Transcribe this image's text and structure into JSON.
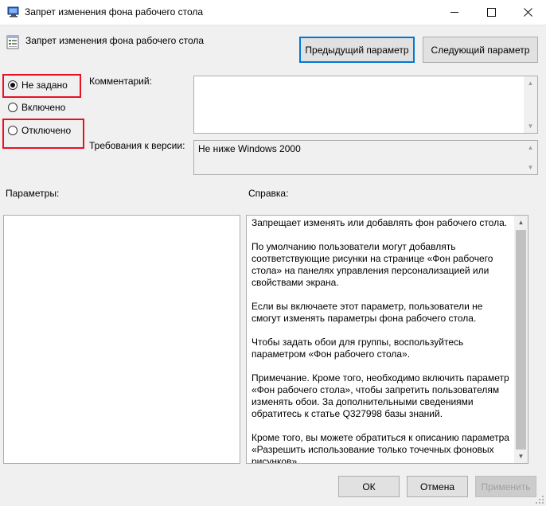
{
  "window": {
    "title": "Запрет изменения фона рабочего стола",
    "minimize_glyph": "—",
    "maximize_glyph": "☐",
    "close_glyph": "✕"
  },
  "header": {
    "policy_name": "Запрет изменения фона рабочего стола",
    "prev_button": "Предыдущий параметр",
    "next_button": "Следующий параметр"
  },
  "state": {
    "options": [
      {
        "label": "Не задано",
        "checked": true
      },
      {
        "label": "Включено",
        "checked": false
      },
      {
        "label": "Отключено",
        "checked": false
      }
    ]
  },
  "comment": {
    "label": "Комментарий:",
    "value": ""
  },
  "requirements": {
    "label": "Требования к версии:",
    "value": "Не ниже Windows 2000"
  },
  "sections": {
    "options_label": "Параметры:",
    "help_label": "Справка:"
  },
  "help": {
    "paragraphs": [
      "Запрещает изменять или добавлять фон рабочего стола.",
      "По умолчанию пользователи могут добавлять соответствующие рисунки на странице «Фон рабочего стола» на панелях управления персонализацией или свойствами экрана.",
      "Если вы включаете этот параметр, пользователи не смогут изменять параметры фона рабочего стола.",
      "Чтобы задать обои для группы, воспользуйтесь параметром «Фон рабочего стола».",
      "Примечание. Кроме того, необходимо включить параметр «Фон рабочего стола», чтобы запретить пользователям изменять обои. За дополнительными сведениями обратитесь к статье Q327998 базы знаний.",
      "Кроме того, вы можете обратиться к описанию параметра «Разрешить использование только точечных фоновых рисунков»."
    ]
  },
  "footer": {
    "ok": "ОК",
    "cancel": "Отмена",
    "apply": "Применить"
  },
  "colors": {
    "highlight": "#e81123",
    "focus": "#0078d7"
  },
  "icons": {
    "app": "policy-editor-icon",
    "policy": "policy-setting-icon"
  }
}
